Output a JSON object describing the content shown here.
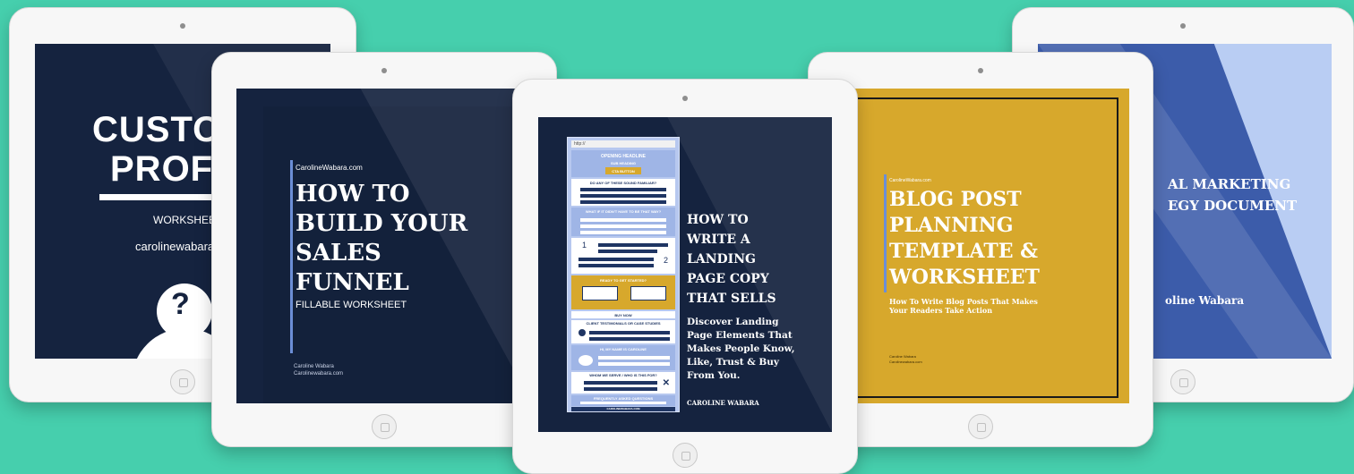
{
  "tablets": {
    "customer": {
      "title_1": "CUSTOM",
      "title_2": "PROFI",
      "subtitle": "WORKSHEET",
      "site": "carolinewabara.c",
      "avatar_symbol": "?"
    },
    "funnel": {
      "site": "CarolineWabara.com",
      "title": [
        "HOW TO",
        "BUILD YOUR",
        "SALES",
        "FUNNEL"
      ],
      "subtitle": "FILLABLE WORKSHEET",
      "author": "Caroline Wabara",
      "author_site": "Carolinewabara.com"
    },
    "landing": {
      "title": [
        "HOW TO",
        "WRITE A",
        "LANDING",
        "PAGE COPY",
        "THAT SELLS"
      ],
      "description": [
        "Discover Landing",
        "Page Elements That",
        "Makes People Know,",
        "Like, Trust & Buy",
        "From You."
      ],
      "author": "CAROLINE WABARA",
      "mock": {
        "url": "http://",
        "heading": "OPENING HEADLINE",
        "subheading": "SUB HEADING",
        "cta": "CTA BUTTON",
        "familiar": "DO ANY OF THESE SOUND FAMILIAR?",
        "what_if": "WHAT IF IT DIDN'T HAVE TO BE THAT WAY?",
        "num_1": "1",
        "num_2": "2",
        "ready": "READY TO GET STARTED?",
        "buy_now": "BUY NOW",
        "testimonials": "CLIENT TESTIMONIALS OR CASE STUDIES",
        "hi": "HI, MY NAME IS CAROLINE",
        "whom": "WHOM WE SERVE / WHO IS THIS FOR?",
        "faq": "FREQUENTLY ASKED QUESTIONS",
        "footer": "CAROLINEWABARA.COM"
      }
    },
    "blog": {
      "site": "CarolineWabara.com",
      "title": [
        "BLOG POST",
        "PLANNING",
        "TEMPLATE &",
        "WORKSHEET"
      ],
      "subtitle": [
        "How To Write Blog Posts That Makes",
        "Your Readers Take Action"
      ],
      "author": "Caroline Wabara",
      "author_site": "Carolinewabara.com"
    },
    "marketing": {
      "title": [
        "AL MARKETING",
        "EGY DOCUMENT"
      ],
      "author": "oline Wabara"
    }
  },
  "colors": {
    "background": "#46cfad",
    "navy": "#15233f",
    "gold": "#d7a82c",
    "light_blue": "#b9cdf3"
  }
}
